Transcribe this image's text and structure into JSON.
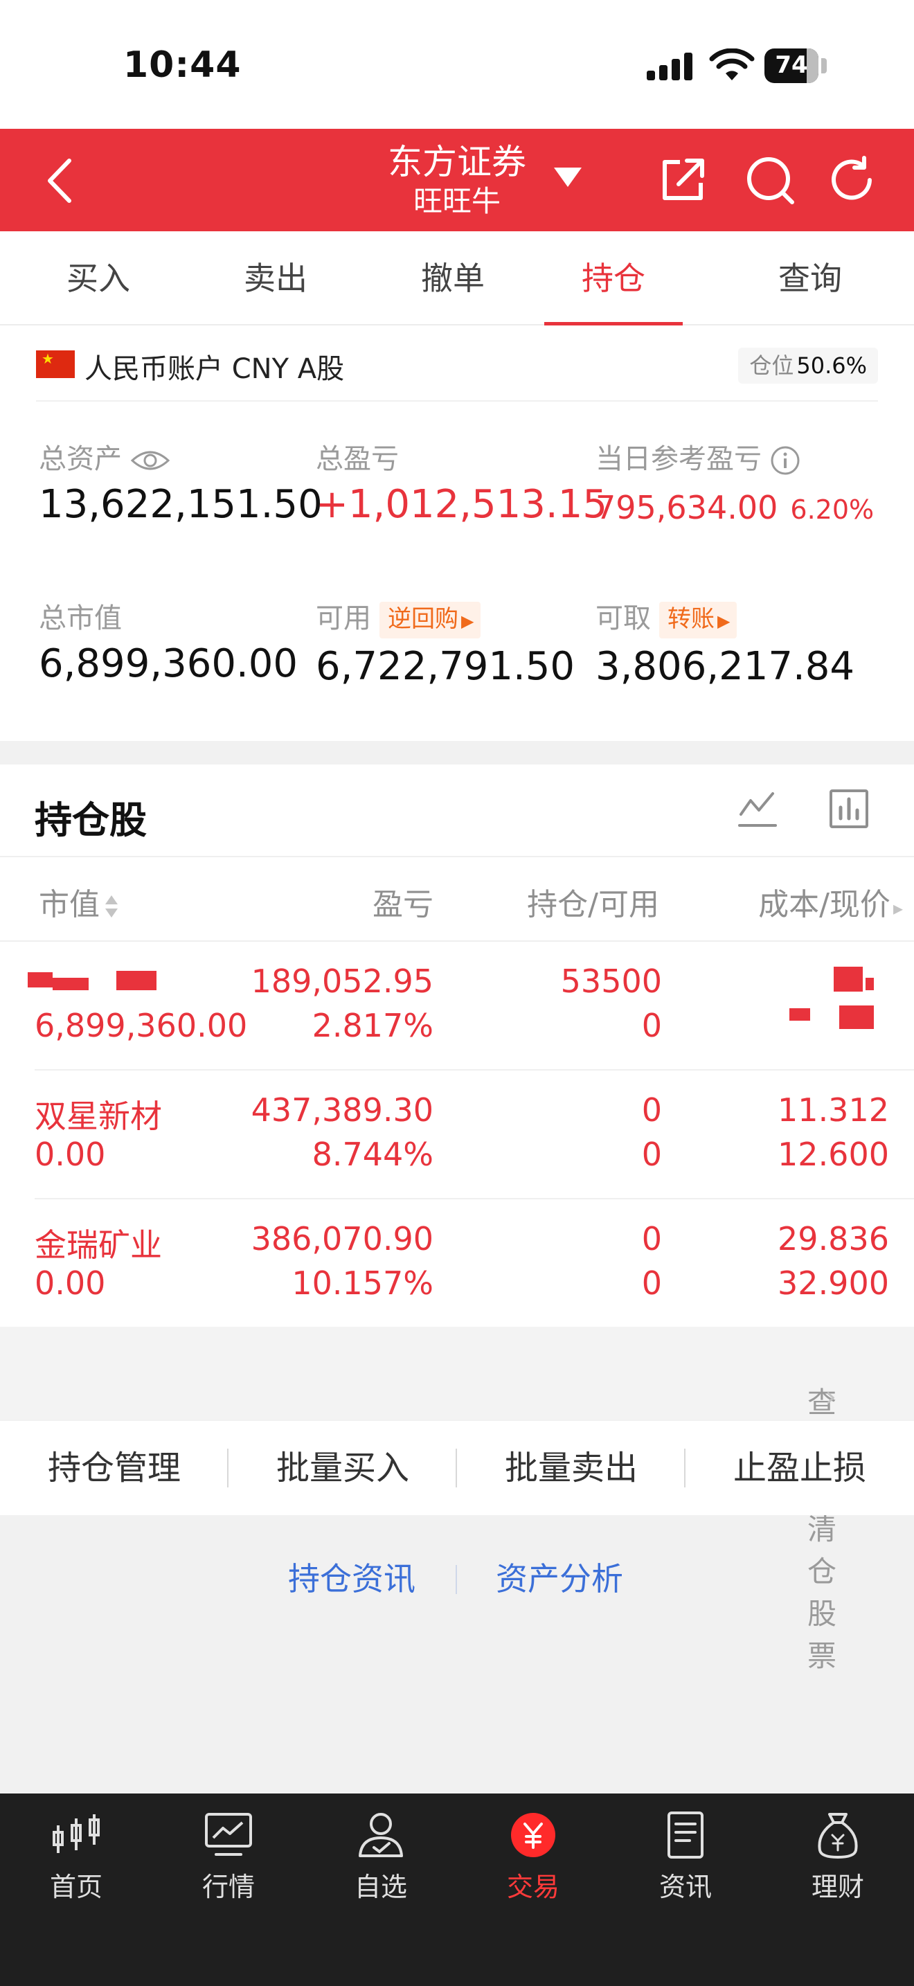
{
  "status_bar": {
    "time": "10:44",
    "battery": "74"
  },
  "header": {
    "title": "东方证券",
    "subtitle": "旺旺牛"
  },
  "tabs": [
    {
      "label": "买入"
    },
    {
      "label": "卖出"
    },
    {
      "label": "撤单"
    },
    {
      "label": "持仓",
      "active": true
    },
    {
      "label": "查询"
    }
  ],
  "account": {
    "name": "人民币账户 CNY A股",
    "position_label": "仓位",
    "position_value": "50.6%",
    "total_assets_label": "总资产",
    "total_assets": "13,622,151.50",
    "total_pnl_label": "总盈亏",
    "total_pnl": "+1,012,513.15",
    "day_pnl_label": "当日参考盈亏",
    "day_pnl": "795,634.00",
    "day_pnl_pct": "6.20%",
    "market_value_label": "总市值",
    "market_value": "6,899,360.00",
    "available_label": "可用",
    "reverse_repo_label": "逆回购",
    "available": "6,722,791.50",
    "withdrawable_label": "可取",
    "transfer_label": "转账",
    "withdrawable": "3,806,217.84"
  },
  "holdings": {
    "title": "持仓股",
    "columns": {
      "market_value": "市值",
      "pnl": "盈亏",
      "position": "持仓/可用",
      "cost": "成本/现价"
    },
    "rows": [
      {
        "name": "",
        "market_value": "6,899,360.00",
        "pnl": "189,052.95",
        "pnl_pct": "2.817%",
        "position": "53500",
        "available": "0",
        "cost": "",
        "price": ""
      },
      {
        "name": "双星新材",
        "market_value": "0.00",
        "pnl": "437,389.30",
        "pnl_pct": "8.744%",
        "position": "0",
        "available": "0",
        "cost": "11.312",
        "price": "12.600"
      },
      {
        "name": "金瑞矿业",
        "market_value": "0.00",
        "pnl": "386,070.90",
        "pnl_pct": "10.157%",
        "position": "0",
        "available": "0",
        "cost": "29.836",
        "price": "32.900"
      }
    ],
    "view_cleared": "查看已清仓股票"
  },
  "actions": [
    {
      "label": "持仓管理"
    },
    {
      "label": "批量买入"
    },
    {
      "label": "批量卖出"
    },
    {
      "label": "止盈止损"
    }
  ],
  "links": {
    "news": "持仓资讯",
    "analysis": "资产分析"
  },
  "nav": [
    {
      "label": "首页",
      "icon": "candlestick-icon"
    },
    {
      "label": "行情",
      "icon": "chart-icon"
    },
    {
      "label": "自选",
      "icon": "user-icon"
    },
    {
      "label": "交易",
      "icon": "yen-icon",
      "active": true
    },
    {
      "label": "资讯",
      "icon": "document-icon"
    },
    {
      "label": "理财",
      "icon": "moneybag-icon"
    }
  ],
  "colors": {
    "accent": "#e8333c",
    "link": "#3b6fd8",
    "nav_bg": "#1f1f1f"
  }
}
